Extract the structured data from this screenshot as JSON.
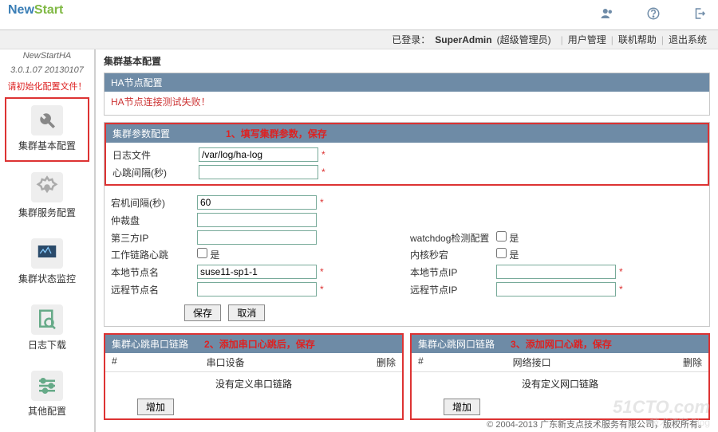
{
  "brand": {
    "part1": "New",
    "part2": "Start"
  },
  "product": {
    "name": "NewStartHA",
    "version": "3.0.1.07 20130107"
  },
  "topIcons": {
    "users": "users-icon",
    "help": "help-icon",
    "logout": "logout-icon"
  },
  "header": {
    "loginPrefix": "已登录：",
    "user": "SuperAdmin",
    "role": "(超级管理员)",
    "menu": [
      "用户管理",
      "联机帮助",
      "退出系统"
    ]
  },
  "sidebar": {
    "warn": "请初始化配置文件！",
    "items": [
      {
        "label": "集群基本配置"
      },
      {
        "label": "集群服务配置"
      },
      {
        "label": "集群状态监控"
      },
      {
        "label": "日志下载"
      },
      {
        "label": "其他配置"
      }
    ]
  },
  "page": {
    "title": "集群基本配置",
    "ha_node_header": "HA节点配置",
    "ha_node_fail": "HA节点连接测试失败！",
    "param_header": "集群参数配置",
    "param_note": "1、填写集群参数，保存",
    "fields": {
      "logfile_lbl": "日志文件",
      "logfile": "/var/log/ha-log",
      "deadtime_lbl": "心跳间隔(秒)",
      "deadtime": "",
      "warntime_lbl": "宕机间隔(秒)",
      "warntime": "60",
      "stonith_lbl": "仲裁盘",
      "stonith": "",
      "thirdip_lbl": "第三方IP",
      "thirdip": "",
      "watchdog_lbl": "watchdog检测配置",
      "watchdog_chk": "是",
      "workhb_lbl": "工作链路心跳",
      "workhb_chk": "是",
      "kernelsec_lbl": "内核秒宕",
      "kernelsec_chk": "是",
      "localname_lbl": "本地节点名",
      "localname": "suse11-sp1-1",
      "localip_lbl": "本地节点IP",
      "localip": "",
      "remotename_lbl": "远程节点名",
      "remotename": "",
      "remoteip_lbl": "远程节点IP",
      "remoteip": ""
    },
    "save": "保存",
    "cancel": "取消",
    "add": "增加",
    "serial": {
      "header": "集群心跳串口链路",
      "note": "2、添加串口心跳后，保存",
      "col_idx": "#",
      "col_dev": "串口设备",
      "col_del": "删除",
      "empty": "没有定义串口链路"
    },
    "net": {
      "header": "集群心跳网口链路",
      "note": "3、添加网口心跳，保存",
      "col_idx": "#",
      "col_if": "网络接口",
      "col_del": "删除",
      "empty": "没有定义网口链路"
    }
  },
  "footer": "© 2004-2013 广东新支点技术服务有限公司，版权所有。",
  "watermark1": "51CTO.com",
  "watermark2": "技术博客   Blog"
}
